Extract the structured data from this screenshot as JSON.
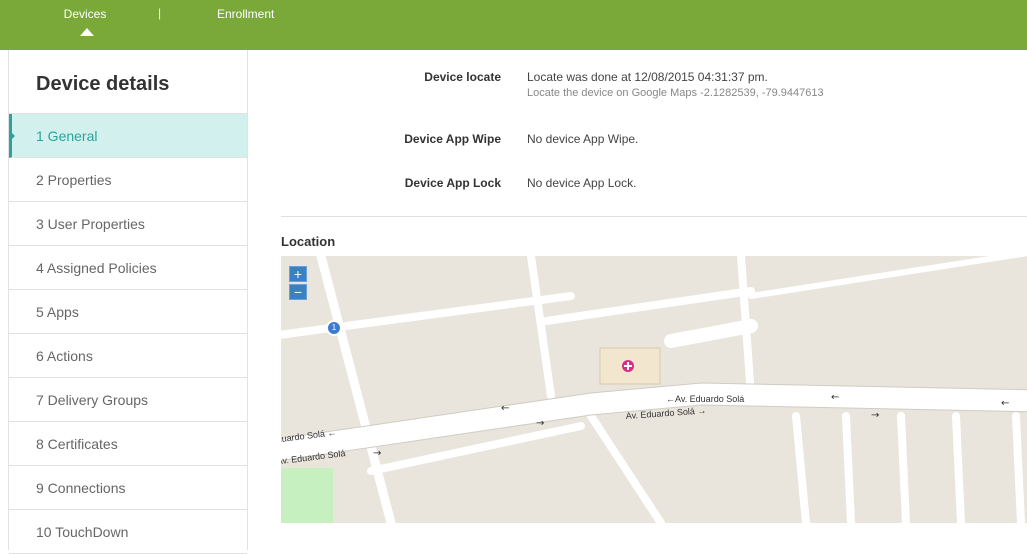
{
  "nav": {
    "tabs": [
      {
        "label": "Devices",
        "active": true
      },
      {
        "label": "Enrollment",
        "active": false
      }
    ],
    "separator": "|"
  },
  "sidebar": {
    "title": "Device details",
    "items": [
      {
        "label": "1  General",
        "active": true
      },
      {
        "label": "2  Properties"
      },
      {
        "label": "3  User Properties"
      },
      {
        "label": "4  Assigned Policies"
      },
      {
        "label": "5  Apps"
      },
      {
        "label": "6  Actions"
      },
      {
        "label": "7  Delivery Groups"
      },
      {
        "label": "8  Certificates"
      },
      {
        "label": "9  Connections"
      },
      {
        "label": "10  TouchDown"
      }
    ]
  },
  "details": {
    "locate": {
      "label": "Device locate",
      "value": "Locate was done at 12/08/2015 04:31:37 pm.",
      "link": "Locate the device on Google Maps -2.1282539, -79.9447613"
    },
    "app_wipe": {
      "label": "Device App Wipe",
      "value": "No device App Wipe."
    },
    "app_lock": {
      "label": "Device App Lock",
      "value": "No device App Lock."
    }
  },
  "location": {
    "title": "Location",
    "zoom_in": "+",
    "zoom_out": "−",
    "cluster_count": "1",
    "street_labels": {
      "upper": "←Av. Eduardo Solá",
      "lower": "Av. Eduardo Solá →",
      "left1": "duardo Solá ←",
      "left2": "Av. Eduardo Solá"
    }
  },
  "colors": {
    "nav_green": "#7aa93a",
    "active_teal": "#2aa39b",
    "active_bg": "#d2f1ee",
    "map_block": "#e9e5dc",
    "map_road": "#ffffff",
    "park": "#c7f0c0",
    "marker_blue": "#3a7bd5"
  }
}
